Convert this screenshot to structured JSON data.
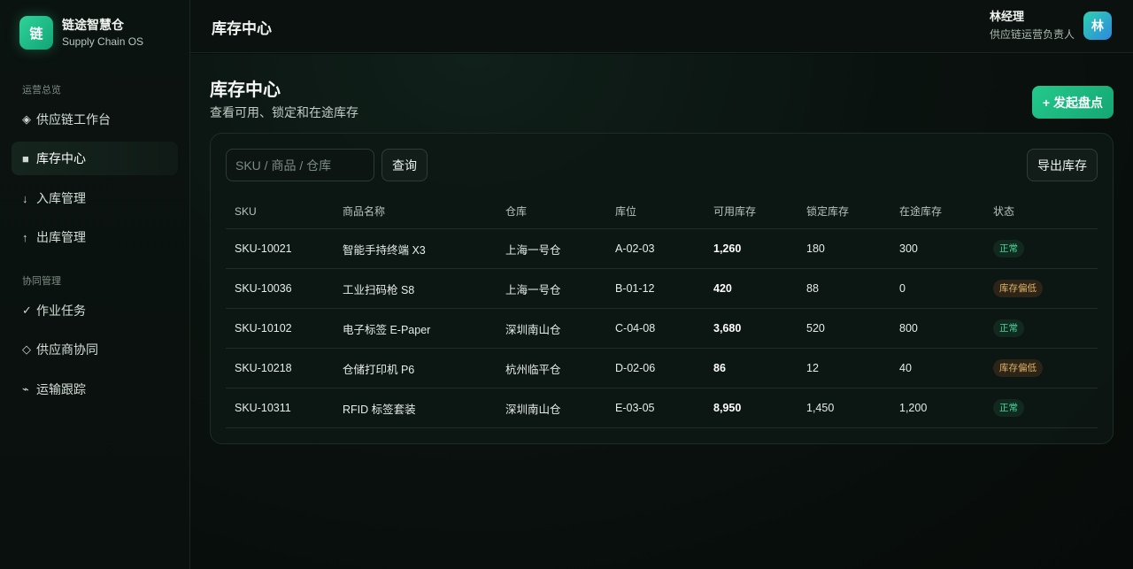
{
  "brand": {
    "logo_char": "链",
    "name": "链途智慧仓",
    "subtitle": "Supply Chain OS"
  },
  "sidebar": {
    "sections": [
      {
        "label": "运营总览"
      },
      {
        "label": "协同管理"
      }
    ],
    "items": [
      {
        "icon": "◈",
        "icon_name": "diamond-icon",
        "label": "供应链工作台"
      },
      {
        "icon": "■",
        "icon_name": "square-icon",
        "label": "库存中心",
        "active": true
      },
      {
        "icon": "↓",
        "icon_name": "arrow-down-icon",
        "label": "入库管理"
      },
      {
        "icon": "↑",
        "icon_name": "arrow-up-icon",
        "label": "出库管理"
      },
      {
        "icon": "✓",
        "icon_name": "check-icon",
        "label": "作业任务"
      },
      {
        "icon": "◇",
        "icon_name": "hollow-diamond-icon",
        "label": "供应商协同"
      },
      {
        "icon": "⌁",
        "icon_name": "route-icon",
        "label": "运输跟踪"
      }
    ]
  },
  "header": {
    "title": "库存中心"
  },
  "user": {
    "name": "林经理",
    "role": "供应链运营负责人",
    "avatar_char": "林"
  },
  "page": {
    "title": "库存中心",
    "subtitle": "查看可用、锁定和在途库存",
    "primary_action": "+ 发起盘点"
  },
  "toolbar": {
    "search_placeholder": "SKU / 商品 / 仓库",
    "query_label": "查询",
    "export_label": "导出库存"
  },
  "table": {
    "columns": [
      "SKU",
      "商品名称",
      "仓库",
      "库位",
      "可用库存",
      "锁定库存",
      "在途库存",
      "状态"
    ],
    "rows": [
      {
        "sku": "SKU-10021",
        "name": "智能手持终端 X3",
        "warehouse": "上海一号仓",
        "location": "A-02-03",
        "available": "1,260",
        "locked": "180",
        "transit": "300",
        "status": "正常",
        "status_type": "ok"
      },
      {
        "sku": "SKU-10036",
        "name": "工业扫码枪 S8",
        "warehouse": "上海一号仓",
        "location": "B-01-12",
        "available": "420",
        "locked": "88",
        "transit": "0",
        "status": "库存偏低",
        "status_type": "low"
      },
      {
        "sku": "SKU-10102",
        "name": "电子标签 E-Paper",
        "warehouse": "深圳南山仓",
        "location": "C-04-08",
        "available": "3,680",
        "locked": "520",
        "transit": "800",
        "status": "正常",
        "status_type": "ok"
      },
      {
        "sku": "SKU-10218",
        "name": "仓储打印机 P6",
        "warehouse": "杭州临平仓",
        "location": "D-02-06",
        "available": "86",
        "locked": "12",
        "transit": "40",
        "status": "库存偏低",
        "status_type": "low"
      },
      {
        "sku": "SKU-10311",
        "name": "RFID 标签套装",
        "warehouse": "深圳南山仓",
        "location": "E-03-05",
        "available": "8,950",
        "locked": "1,450",
        "transit": "1,200",
        "status": "正常",
        "status_type": "ok"
      }
    ]
  }
}
